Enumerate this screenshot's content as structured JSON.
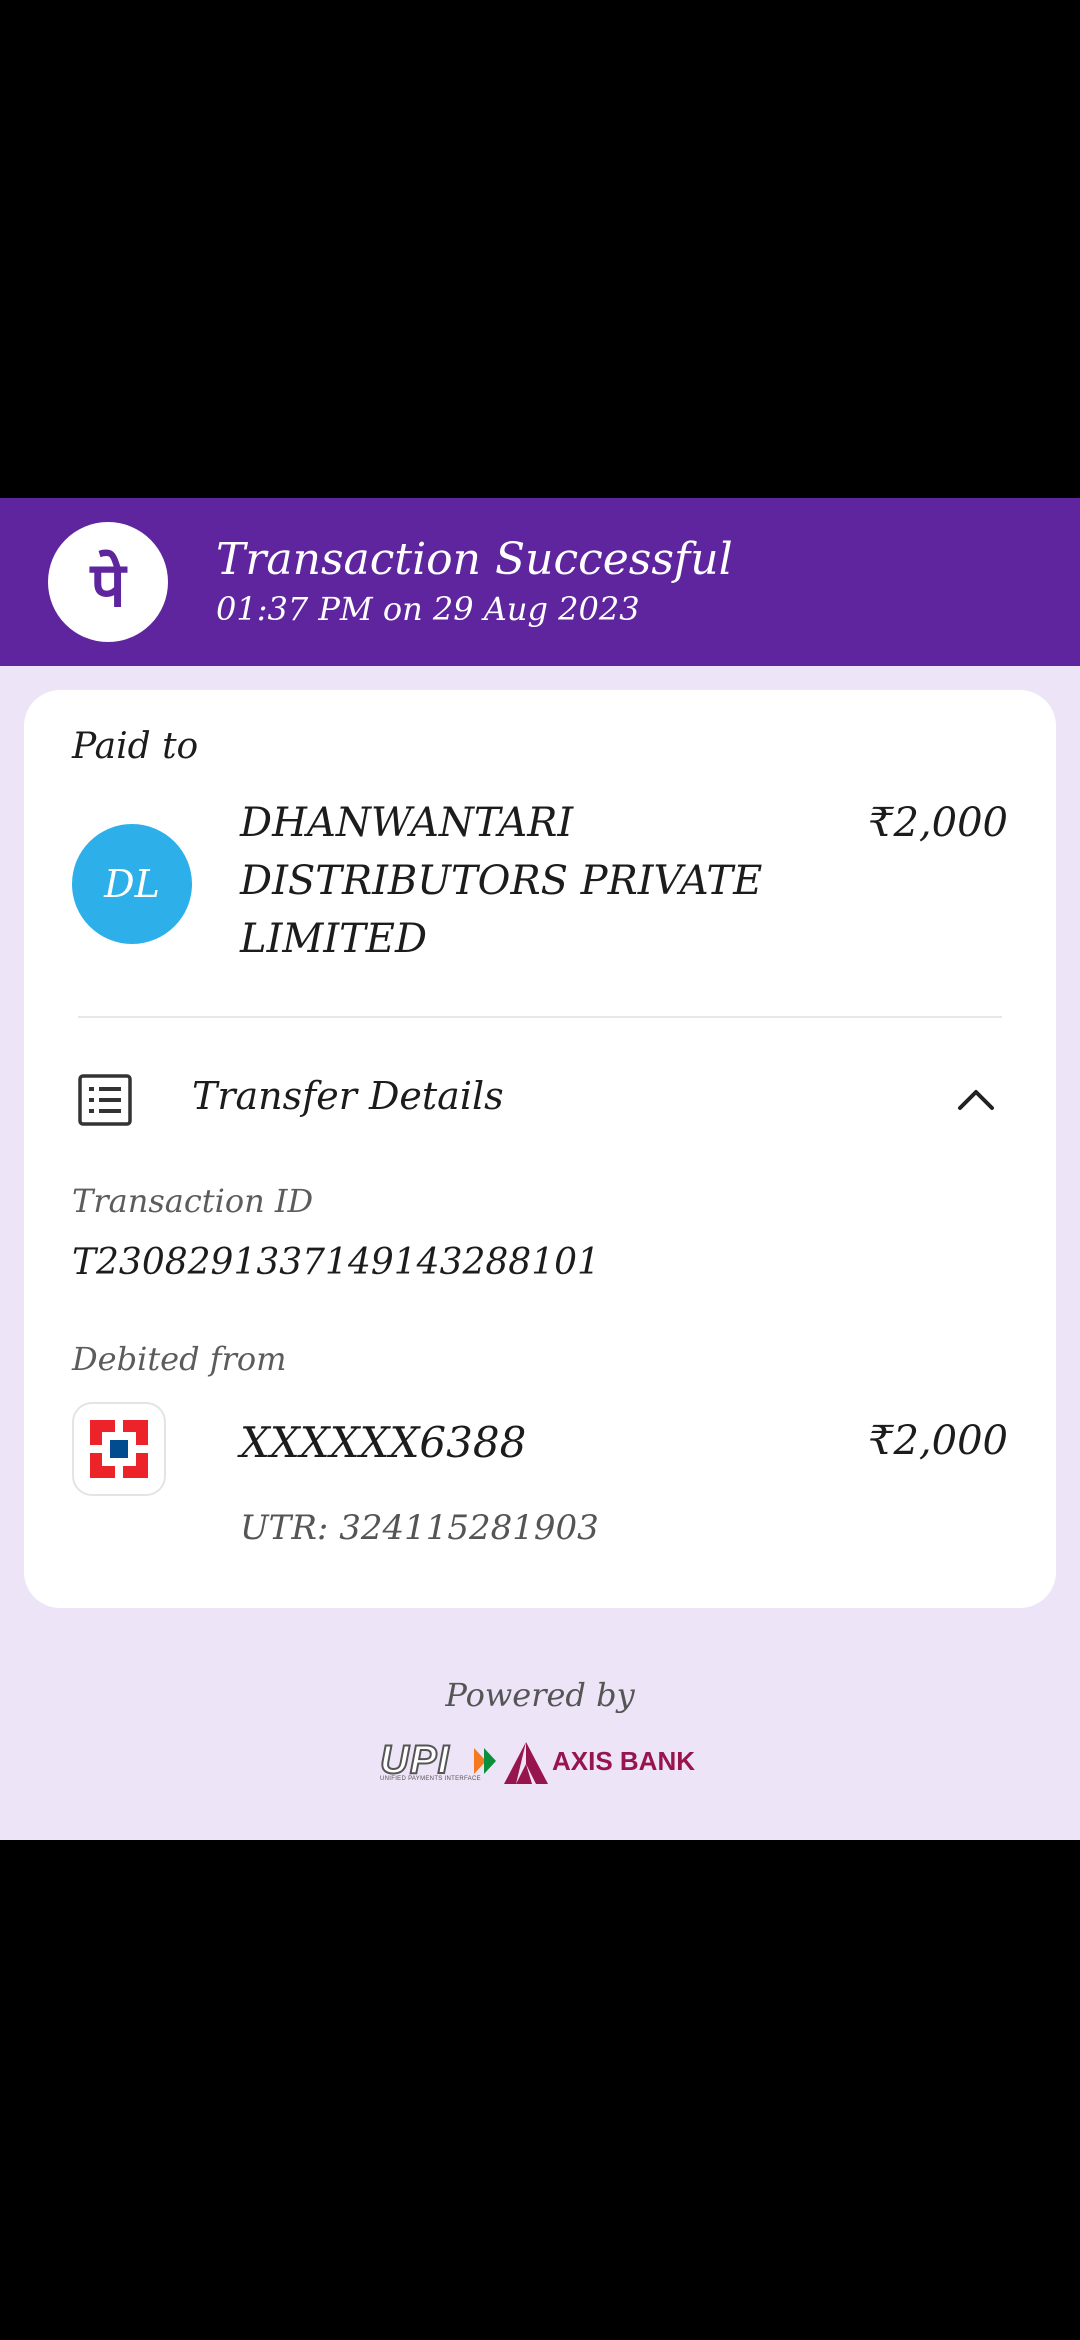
{
  "header": {
    "title": "Transaction Successful",
    "datetime": "01:37 PM on 29 Aug 2023",
    "logo_glyph": "पे",
    "brand_color": "#5f259f"
  },
  "paid_to": {
    "label": "Paid to",
    "avatar_initials": "DL",
    "avatar_color": "#2db0ea",
    "payee_name": "DHANWANTARI DISTRIBUTORS PRIVATE LIMITED",
    "amount": "₹2,000"
  },
  "transfer_details": {
    "label": "Transfer Details",
    "icon": "list-icon",
    "toggle_icon": "chevron-up-icon",
    "transaction_id_label": "Transaction ID",
    "transaction_id": "T2308291337149143288101",
    "debited_from_label": "Debited from",
    "account_number": "XXXXXX6388",
    "account_amount": "₹2,000",
    "utr": "UTR: 324115281903",
    "bank_icon": "hdfc-bank-icon"
  },
  "footer": {
    "powered_by": "Powered by",
    "upi_label": "UPI",
    "upi_subtitle": "UNIFIED PAYMENTS INTERFACE",
    "bank_name": "AXIS BANK",
    "bank_color": "#97144d"
  },
  "colors": {
    "page_background": "#ede4f7",
    "card_background": "#ffffff"
  }
}
